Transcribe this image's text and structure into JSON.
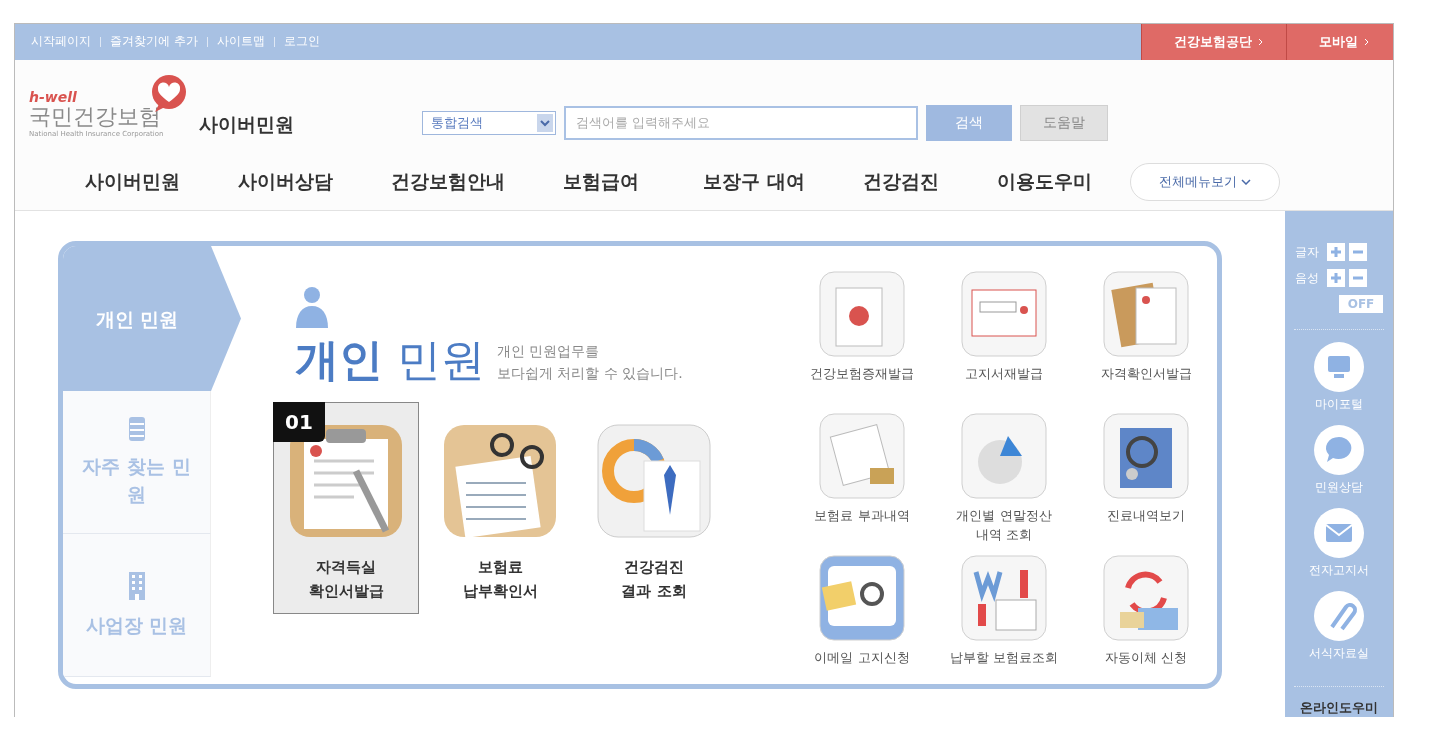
{
  "top_links": [
    "시작페이지",
    "즐겨찾기에 추가",
    "사이트맵",
    "로그인"
  ],
  "top_buttons": [
    "건강보험공단",
    "모바일"
  ],
  "logo": {
    "tagline": "h-well",
    "name": "국민건강보험",
    "subtitle": "National Health Insurance Corporation"
  },
  "site_title": "사이버민원",
  "search": {
    "scope": "통합검색",
    "placeholder": "검색어를 입력해주세요",
    "buttons": [
      "검색",
      "도움말"
    ]
  },
  "nav": {
    "items": [
      "사이버민원",
      "사이버상담",
      "건강보험안내",
      "보험급여",
      "보장구 대여",
      "건강검진",
      "이용도우미"
    ],
    "all_menu": "전체메뉴보기"
  },
  "side_tabs": [
    {
      "label": "개인 민원",
      "selected": true
    },
    {
      "label": "자주 찾는 민원",
      "selected": false
    },
    {
      "label": "사업장 민원",
      "selected": false
    }
  ],
  "heading": "**개인** 민원",
  "description": [
    "개인 민원업무를",
    "보다쉽게 처리할 수 있습니다."
  ],
  "featured": [
    {
      "badge": "01",
      "lines": [
        "자격득실",
        "확인서발급"
      ],
      "selected": true
    },
    {
      "lines": [
        "보험료",
        "납부확인서"
      ],
      "selected": false
    },
    {
      "lines": [
        "건강검진",
        "결과 조회"
      ],
      "selected": false
    }
  ],
  "services": [
    {
      "lines": [
        "건강보험증재발급"
      ]
    },
    {
      "lines": [
        "고지서재발급"
      ]
    },
    {
      "lines": [
        "자격확인서발급"
      ]
    },
    {
      "lines": [
        "보험료 부과내역"
      ]
    },
    {
      "lines": [
        "개인별 연말정산",
        "내역 조회"
      ]
    },
    {
      "lines": [
        "진료내역보기"
      ]
    },
    {
      "lines": [
        "이메일 고지신청"
      ]
    },
    {
      "lines": [
        "납부할 보험료조회"
      ]
    },
    {
      "lines": [
        "자동이체 신청"
      ]
    }
  ],
  "rail": {
    "font_label": "글자",
    "voice_label": "음성",
    "voice_off": "OFF",
    "links": [
      "마이포털",
      "민원상담",
      "전자고지서",
      "서식자료실"
    ],
    "helper": "온라인도우미"
  }
}
